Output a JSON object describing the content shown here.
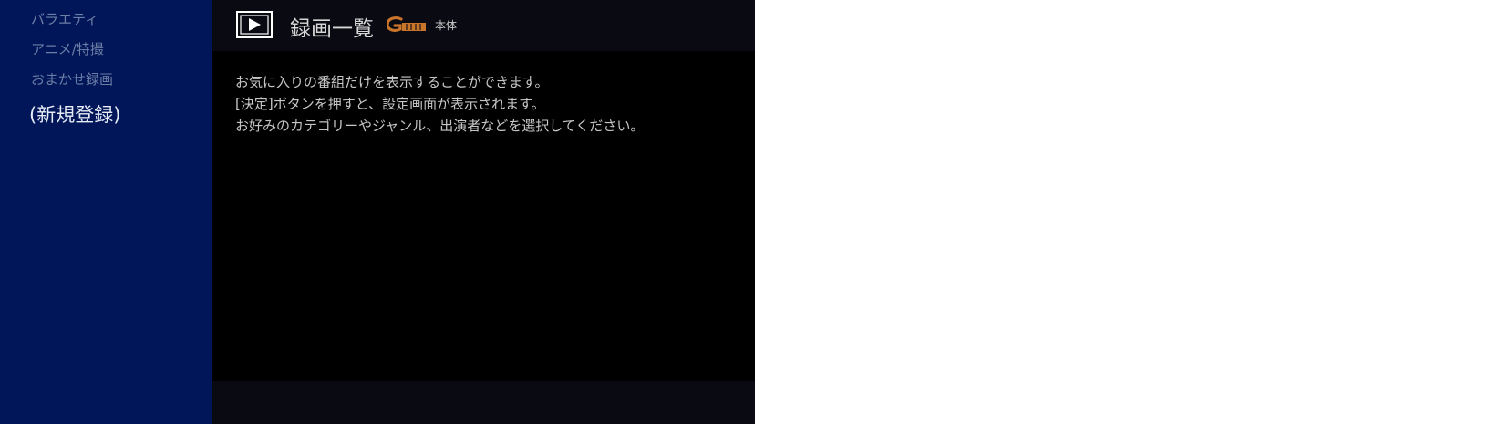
{
  "sidebar": {
    "items": [
      {
        "label": "バラエティ"
      },
      {
        "label": "アニメ/特撮"
      },
      {
        "label": "おまかせ録画"
      },
      {
        "label": "(新規登録)"
      }
    ]
  },
  "header": {
    "title": "録画一覧",
    "logo": "G-GUIDE",
    "source": "本体"
  },
  "message": {
    "lines": [
      "お気に入りの番組だけを表示することができます。",
      "[決定]ボタンを押すと、設定画面が表示されます。",
      "お好みのカテゴリーやジャンル、出演者などを選択してください。"
    ]
  },
  "colors": {
    "sidebar_bg": "#001659",
    "logo_orange": "#c8742a"
  },
  "icons": {
    "play": "play-icon",
    "logo": "gguide-logo"
  }
}
